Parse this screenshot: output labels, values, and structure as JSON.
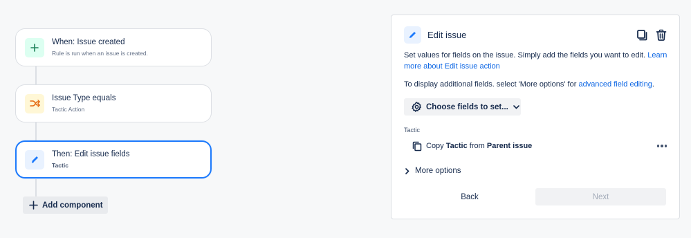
{
  "flow": {
    "nodes": [
      {
        "title": "When: Issue created",
        "subtitle": "Rule is run when an issue is created.",
        "icon": "plus-icon"
      },
      {
        "title": "Issue Type equals",
        "subtitle": "Tactic Action",
        "icon": "shuffle-icon"
      },
      {
        "title": "Then: Edit issue fields",
        "subtitle": "Tactic",
        "icon": "pencil-icon"
      }
    ],
    "add_component_label": "Add component"
  },
  "panel": {
    "title": "Edit issue",
    "description": "Set values for fields on the issue. Simply add the fields you want to edit.",
    "learn_more_link": "Learn more about Edit issue action",
    "additional_text": "To display additional fields. select 'More options' for",
    "advanced_link": "advanced field editing",
    "choose_fields_label": "Choose fields to set...",
    "field": {
      "label": "Tactic",
      "copy_word": "Copy",
      "field_name": "Tactic",
      "from_word": "from",
      "source": "Parent issue"
    },
    "more_options_label": "More options",
    "back_label": "Back",
    "next_label": "Next"
  },
  "colors": {
    "accent": "#1d7afc",
    "link": "#0c66e4",
    "trigger_bg": "#dcfff1",
    "condition_bg": "#fff7d6",
    "action_bg": "#e9f2ff"
  }
}
